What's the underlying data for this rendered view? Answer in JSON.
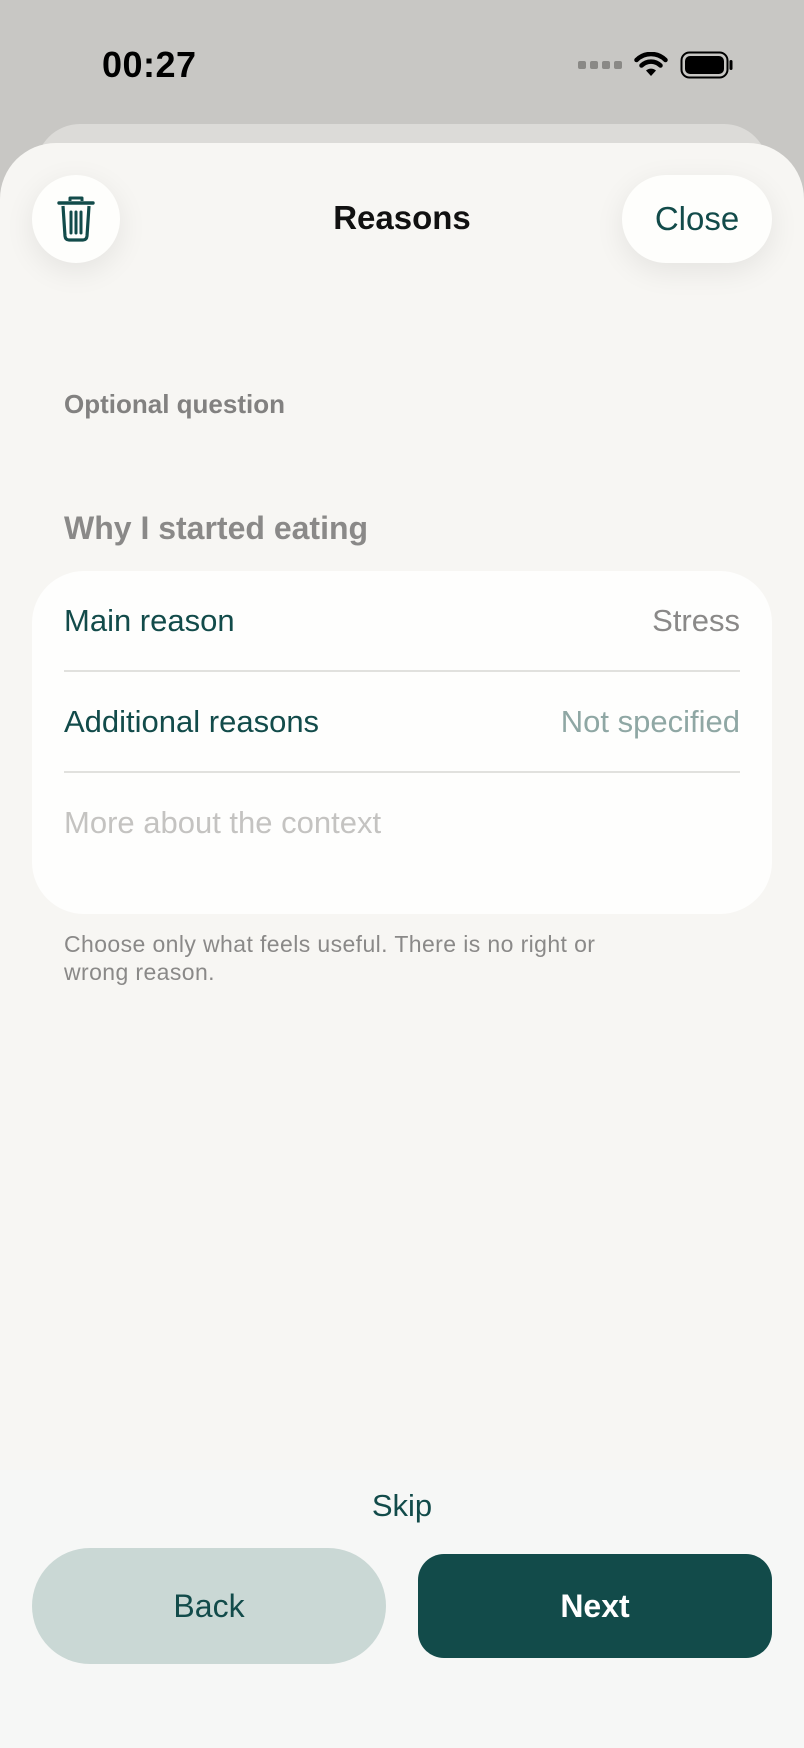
{
  "status_bar": {
    "time": "00:27",
    "icons": [
      "signal-dots-icon",
      "wifi-icon",
      "battery-icon"
    ]
  },
  "header": {
    "title": "Reasons",
    "close_label": "Close",
    "delete_icon": "trash-icon"
  },
  "content": {
    "optional_label": "Optional question",
    "section_title": "Why I started eating",
    "rows": [
      {
        "label": "Main reason",
        "value": "Stress"
      },
      {
        "label": "Additional reasons",
        "value": "Not specified"
      }
    ],
    "context_placeholder": "More about the context",
    "helper_text": "Choose only what feels useful. There is no right or wrong reason."
  },
  "footer": {
    "skip_label": "Skip",
    "back_label": "Back",
    "next_label": "Next"
  },
  "colors": {
    "accent": "#124b4a",
    "sheet_background": "#f7f6f3",
    "back_button": "#cad8d5"
  }
}
